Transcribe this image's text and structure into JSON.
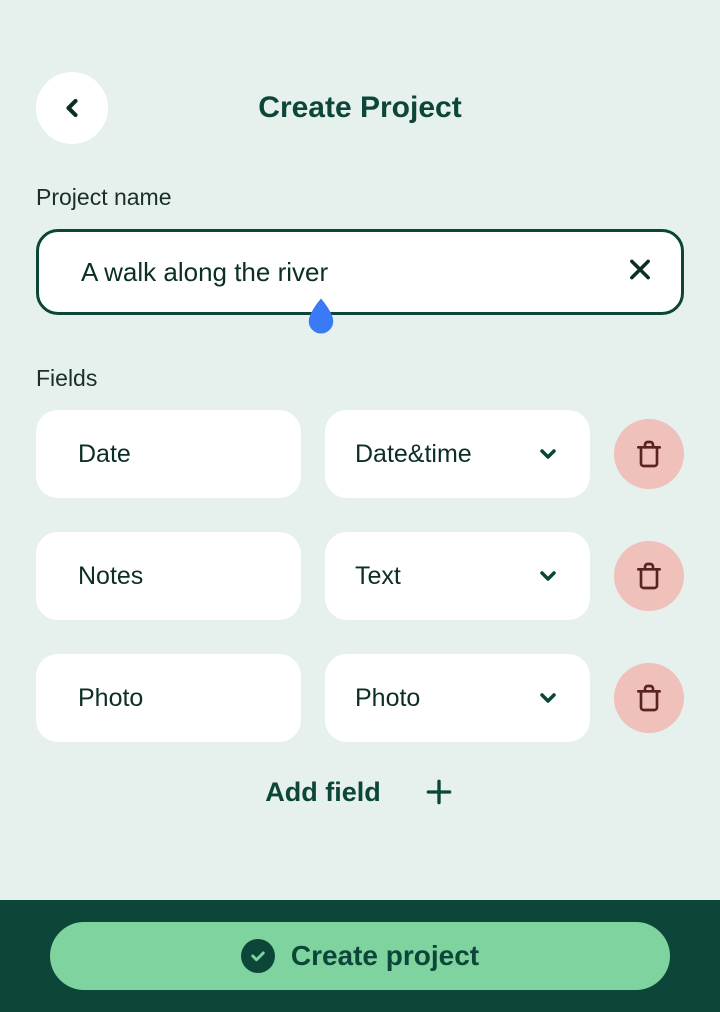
{
  "header": {
    "title": "Create Project"
  },
  "projectName": {
    "label": "Project name",
    "value": "A walk along the river"
  },
  "fields": {
    "label": "Fields",
    "rows": [
      {
        "name": "Date",
        "type": "Date&time"
      },
      {
        "name": "Notes",
        "type": "Text"
      },
      {
        "name": "Photo",
        "type": "Photo"
      }
    ]
  },
  "addField": {
    "label": "Add field"
  },
  "footer": {
    "createLabel": "Create project"
  }
}
